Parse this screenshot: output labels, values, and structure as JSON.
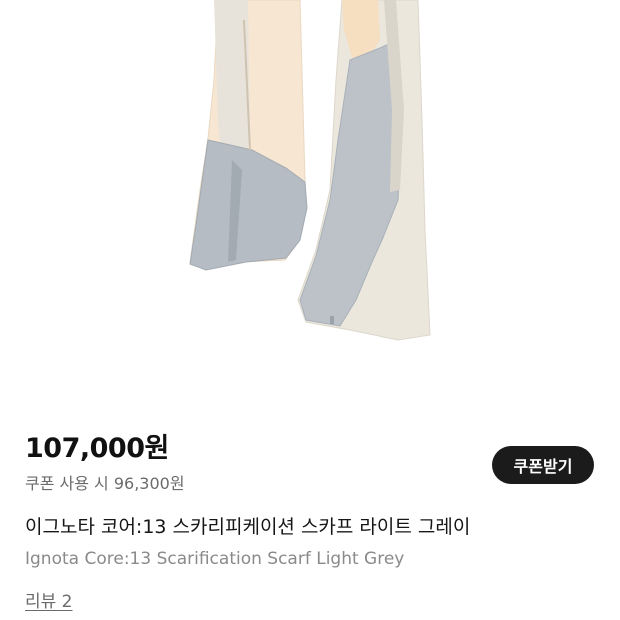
{
  "product": {
    "image_alt": "",
    "price": "107,000원",
    "coupon_price_text": "쿠폰 사용 시 96,300원",
    "coupon_button_label": "쿠폰받기",
    "title_ko": "이그노타 코어:13 스카리피케이션 스카프 라이트 그레이",
    "title_en": "Ignota Core:13 Scarification Scarf Light Grey",
    "review_label": "리뷰 2"
  },
  "colors": {
    "price_text": "#111111",
    "secondary_text": "#6b6b6b",
    "english_title_text": "#8a8a8a",
    "button_background": "#1b1b1b",
    "button_text": "#ffffff",
    "scarf_grey": "#b9bec3",
    "scarf_peach": "#f6e3cc",
    "scarf_cream": "#ece8de"
  }
}
